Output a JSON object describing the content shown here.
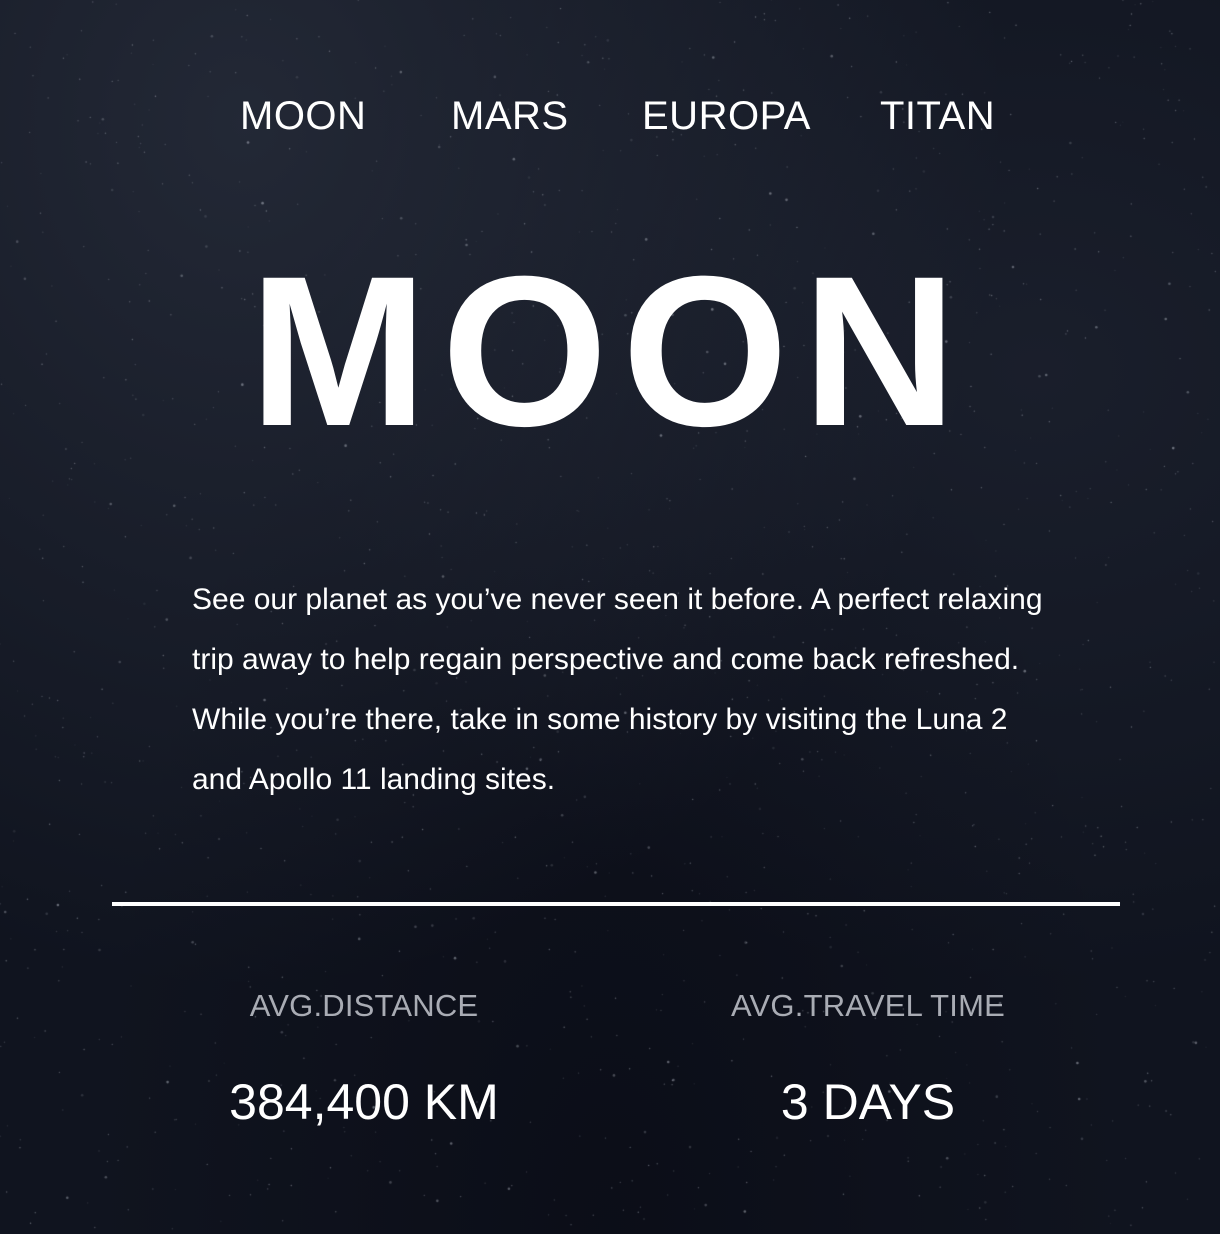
{
  "nav": {
    "tabs": [
      {
        "label": "MOON"
      },
      {
        "label": "MARS"
      },
      {
        "label": "EUROPA"
      },
      {
        "label": "TITAN"
      }
    ]
  },
  "destination": {
    "title": "MOON",
    "description": "See our planet as you’ve never seen it before. A perfect relaxing trip away to help regain perspective and come back refreshed. While you’re there, take in some history by visiting the Luna 2 and Apollo 11 landing sites."
  },
  "stats": {
    "distance": {
      "label": "AVG.DISTANCE",
      "value": "384,400 KM"
    },
    "travel_time": {
      "label": "AVG.TRAVEL TIME",
      "value": "3 DAYS"
    }
  },
  "colors": {
    "background": "#10141f",
    "text": "#ffffff",
    "muted_text": "#a9acb4"
  }
}
